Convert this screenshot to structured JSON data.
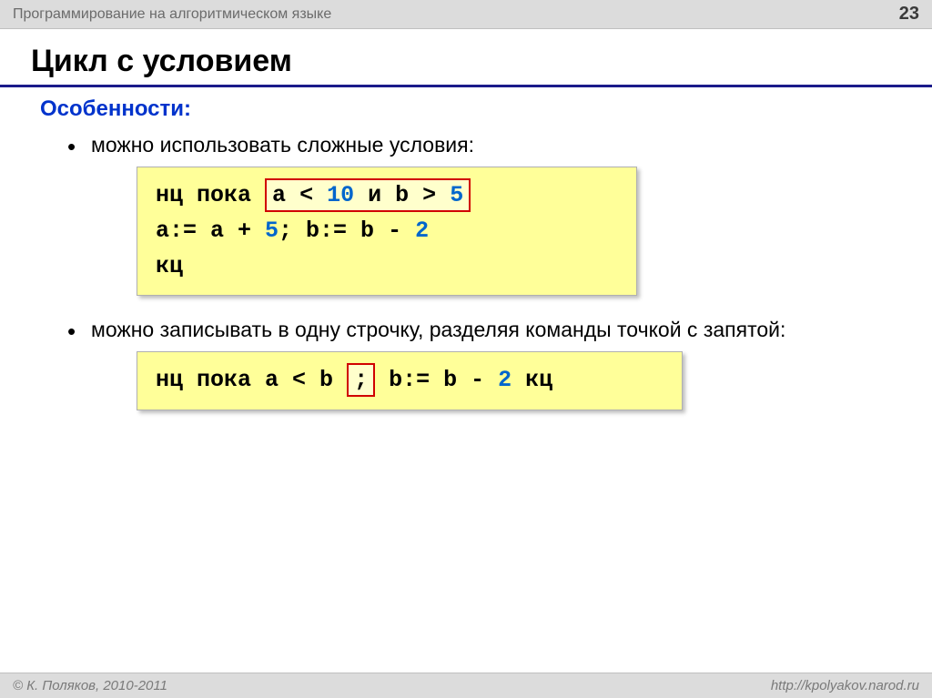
{
  "header": {
    "course": "Программирование на алгоритмическом языке",
    "page": "23"
  },
  "title": "Цикл с условием",
  "subhead": "Особенности:",
  "bullets": {
    "b1": "можно использовать сложные условия:",
    "b2": "можно записывать в одну строчку, разделяя команды точкой с запятой:"
  },
  "code1": {
    "l1a": "нц пока ",
    "cond_a": "a",
    "cond_lt": "<",
    "cond_10": "10",
    "cond_and": " и ",
    "cond_b": "b",
    "cond_gt": ">",
    "cond_5": "5",
    "l2_indent": "  ",
    "l2_a": "a:= a + ",
    "l2_5": "5",
    "l2_sep": "; b:= b - ",
    "l2_2": "2",
    "l3": "кц"
  },
  "code2": {
    "pre": "нц пока a < b",
    "semi": ";",
    "post_a": " b:= b - ",
    "post_2": "2",
    "post_b": "  кц"
  },
  "footer": {
    "copyright": "© К. Поляков, 2010-2011",
    "url": "http://kpolyakov.narod.ru"
  }
}
